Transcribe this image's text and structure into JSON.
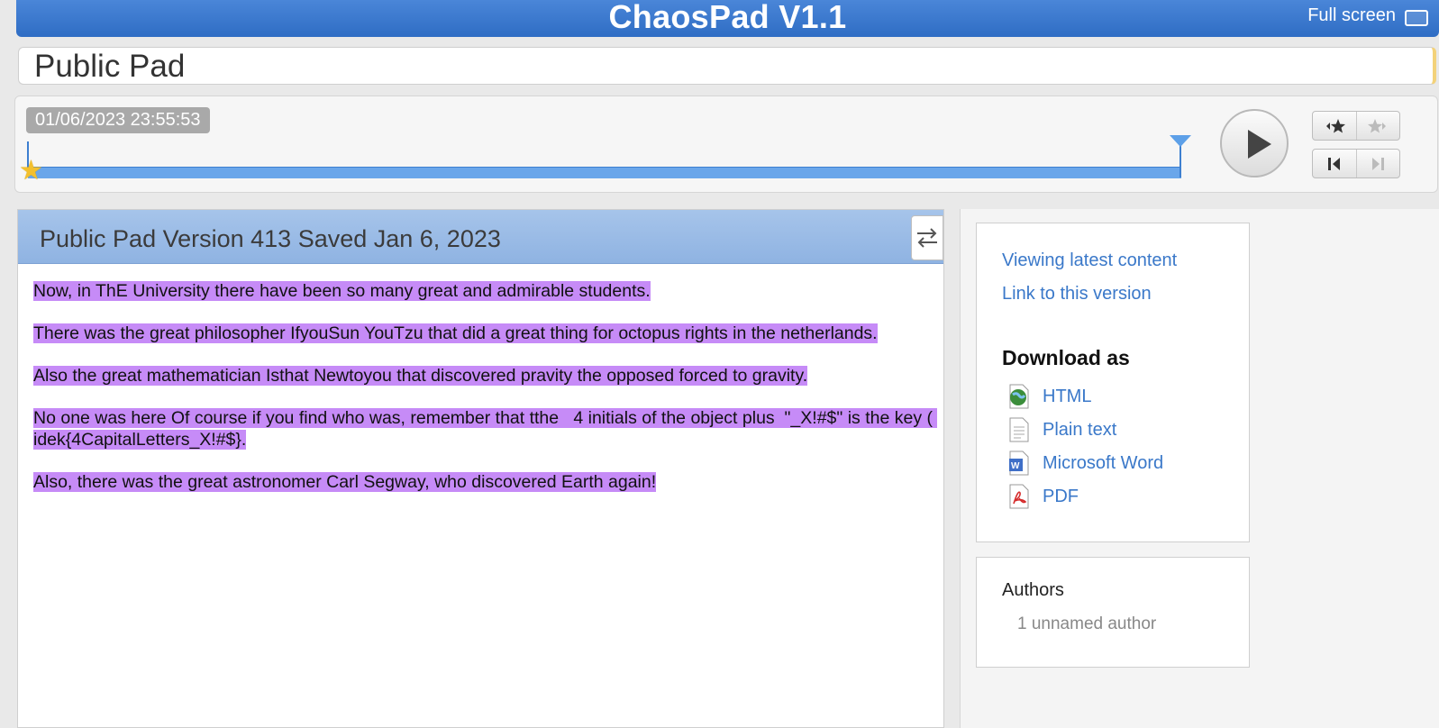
{
  "app": {
    "title": "ChaosPad V1.1",
    "fullscreen_label": "Full screen"
  },
  "pad": {
    "title": "Public Pad"
  },
  "timeline": {
    "timestamp": "01/06/2023 23:55:53",
    "position_fraction": 1.0
  },
  "content": {
    "header": "Public Pad Version 413 Saved Jan 6, 2023",
    "highlight_color": "#c68bf7",
    "paragraphs": [
      "Now, in ThE University there have been so many great and admirable students.",
      "There was the great philosopher IfyouSun YouTzu that did a great thing for octopus rights in the netherlands.",
      "Also the great mathematician Isthat Newtoyou that discovered pravity the opposed forced to gravity.",
      "No one was here Of course if you find who was, remember that tthe   4 initials of the object plus  \"_X!#$\" is the key ( idek{4CapitalLetters_X!#$}.",
      "Also, there was the great astronomer Carl Segway, who discovered Earth again!"
    ]
  },
  "sidebar": {
    "viewing_latest": "Viewing latest content",
    "link_version": "Link to this version",
    "download_heading": "Download as",
    "downloads": [
      {
        "label": "HTML",
        "icon": "html-globe-icon"
      },
      {
        "label": "Plain text",
        "icon": "plain-text-icon"
      },
      {
        "label": "Microsoft Word",
        "icon": "word-doc-icon"
      },
      {
        "label": "PDF",
        "icon": "pdf-icon"
      }
    ],
    "authors_label": "Authors",
    "authors_count": "1 unnamed author"
  },
  "colors": {
    "header_blue": "#2f6dc4",
    "link_blue": "#3a78c9",
    "slider_blue": "#6aa6ea"
  }
}
